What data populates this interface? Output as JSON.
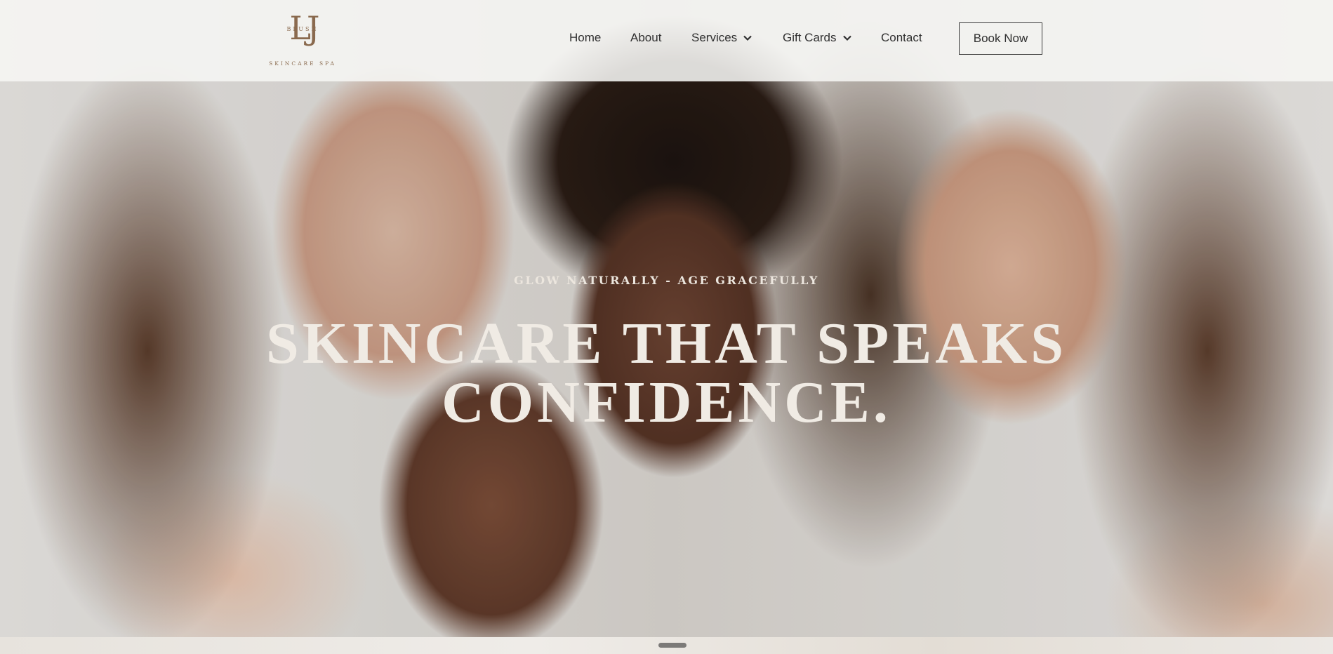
{
  "logo": {
    "mark": "LJ",
    "small_text": "BLUSH",
    "subtitle": "SKINCARE SPA",
    "color": "#8a6a4e"
  },
  "nav": {
    "items": [
      {
        "label": "Home"
      },
      {
        "label": "About"
      },
      {
        "label": "Services",
        "icon": "chevron-down-icon"
      },
      {
        "label": "Gift Cards",
        "icon": "chevron-down-icon"
      },
      {
        "label": "Contact"
      }
    ],
    "cta_label": "Book Now"
  },
  "hero": {
    "tagline": "GLOW NATURALLY - AGE GRACEFULLY",
    "headline_line1": "SKINCARE THAT SPEAKS",
    "headline_line2": "CONFIDENCE."
  },
  "colors": {
    "header_bg": "#f6f6f4",
    "text": "#2f2f2f",
    "hero_text": "#f0ebe4"
  }
}
